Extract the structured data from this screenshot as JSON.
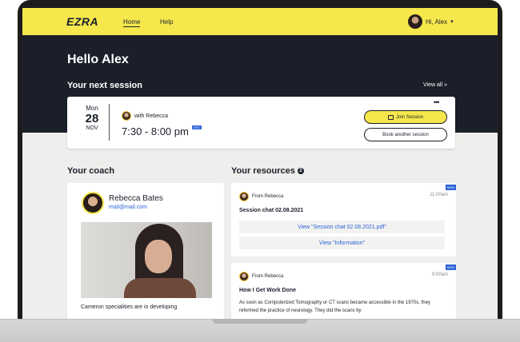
{
  "nav": {
    "logo": "EZRA",
    "home": "Home",
    "help": "Help",
    "user_greeting": "Hi, Alex"
  },
  "hero": {
    "greeting": "Hello Alex",
    "next_session_heading": "Your next session",
    "view_all": "View all"
  },
  "session": {
    "weekday": "Mon",
    "day": "28",
    "month": "NOV",
    "with": "with Rebecca",
    "time": "7:30 - 8:00 pm",
    "timezone": "EST",
    "more": "•••",
    "join_label": "Join Session",
    "book_label": "Book another session"
  },
  "coach": {
    "heading": "Your coach",
    "name": "Rebecca Bates",
    "email": "mail@mail.com",
    "description": "Cameron specialities are in developing"
  },
  "resources": {
    "heading": "Your resources",
    "count": "2",
    "items": [
      {
        "badge": "NEW",
        "from": "From Rebecca",
        "time": "11:00am",
        "title": "Session chat 02.08.2021",
        "links": [
          "View \"Session chat 02.08.2021.pdf\"",
          "View \"Information\""
        ]
      },
      {
        "badge": "NEW",
        "from": "From Rebecca",
        "time": "9:00am",
        "title": "How I Get Work Done",
        "text": "As soon as Computerized Tomography or CT scans became accessible in the 1970s, they reformed the practice of neurology. They did the scans by"
      }
    ]
  },
  "icons": {
    "user": "avatar",
    "chevron": "chevron-down-icon",
    "view_all": "chevron-right-icon",
    "camera": "video-camera-icon"
  },
  "colors": {
    "brand_yellow": "#f6e84c",
    "dark": "#1b1f2a",
    "link_blue": "#2d62d8"
  }
}
